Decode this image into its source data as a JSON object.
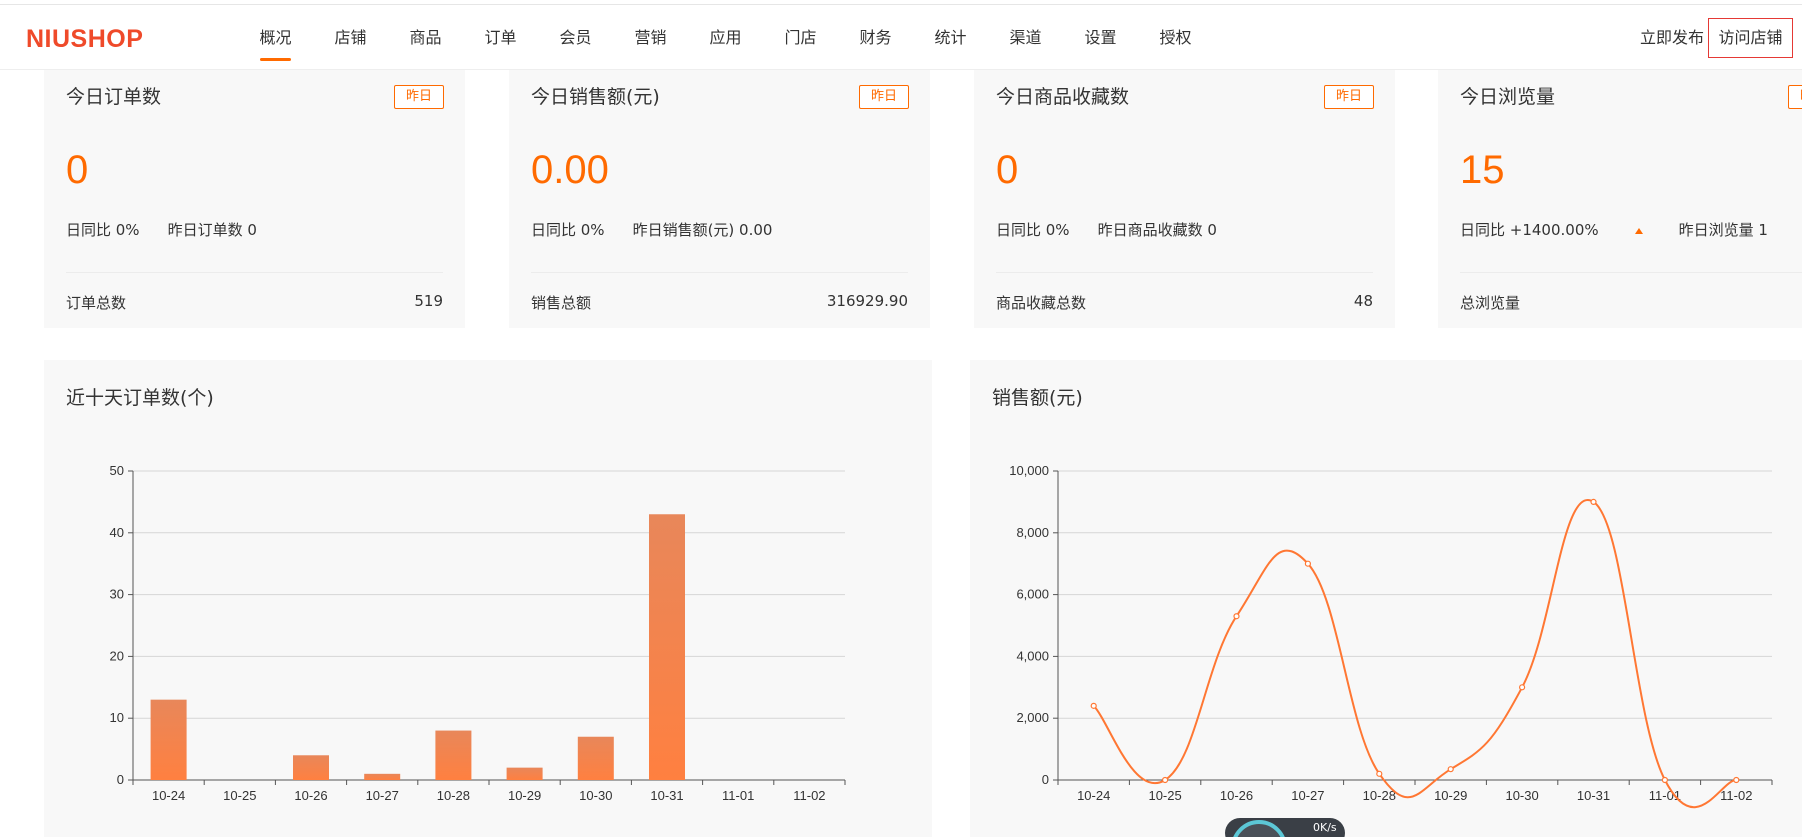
{
  "header": {
    "logo_text": "NIUSHOP",
    "nav": [
      "概况",
      "店铺",
      "商品",
      "订单",
      "会员",
      "营销",
      "应用",
      "门店",
      "财务",
      "统计",
      "渠道",
      "设置",
      "授权"
    ],
    "active_nav": "概况",
    "publish_label": "立即发布",
    "visit_label": "访问店铺"
  },
  "cards": [
    {
      "title": "今日订单数",
      "btn": "昨日",
      "value": "0",
      "compare": "日同比 0%",
      "yesterday": "昨日订单数 0",
      "total_label": "订单总数",
      "total_value": "519"
    },
    {
      "title": "今日销售额(元)",
      "btn": "昨日",
      "value": "0.00",
      "compare": "日同比 0%",
      "yesterday": "昨日销售额(元) 0.00",
      "total_label": "销售总额",
      "total_value": "316929.90"
    },
    {
      "title": "今日商品收藏数",
      "btn": "昨日",
      "value": "0",
      "compare": "日同比 0%",
      "yesterday": "昨日商品收藏数 0",
      "total_label": "商品收藏总数",
      "total_value": "48"
    },
    {
      "title": "今日浏览量",
      "btn": "昨日",
      "value": "15",
      "compare": "日同比 +1400.00%",
      "yesterday": "昨日浏览量 1",
      "total_label": "总浏览量",
      "total_value": ""
    }
  ],
  "chart_data": [
    {
      "type": "bar",
      "title": "近十天订单数(个)",
      "categories": [
        "10-24",
        "10-25",
        "10-26",
        "10-27",
        "10-28",
        "10-29",
        "10-30",
        "10-31",
        "11-01",
        "11-02"
      ],
      "values": [
        13,
        0,
        4,
        1,
        8,
        2,
        7,
        43,
        0,
        0
      ],
      "yticks": [
        "0",
        "10",
        "20",
        "30",
        "40",
        "50"
      ],
      "ylim": [
        0,
        50
      ],
      "grid": true,
      "color_top": "#e8875a",
      "color_bottom": "#ff8040"
    },
    {
      "type": "line",
      "title": "销售额(元)",
      "categories": [
        "10-24",
        "10-25",
        "10-26",
        "10-27",
        "10-28",
        "10-29",
        "10-30",
        "10-31",
        "11-01",
        "11-02"
      ],
      "values": [
        2400,
        0,
        5300,
        7000,
        200,
        350,
        3000,
        9000,
        0,
        0
      ],
      "yticks": [
        "0",
        "2,000",
        "4,000",
        "6,000",
        "8,000",
        "10,000"
      ],
      "ylim": [
        0,
        10000
      ],
      "grid": true,
      "color": "#ff7733"
    }
  ],
  "overlay": {
    "text": "0K/s"
  }
}
